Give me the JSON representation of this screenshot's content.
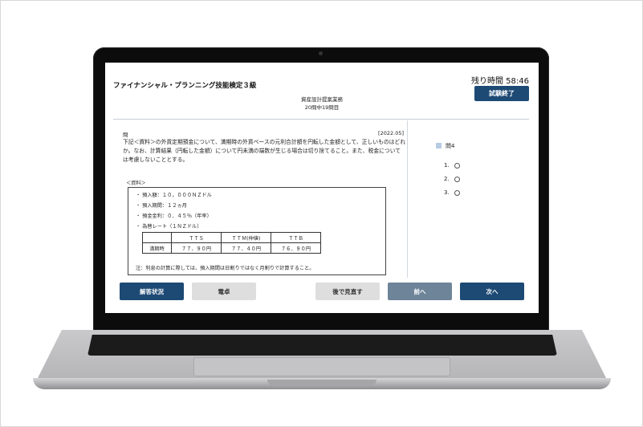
{
  "header": {
    "exam_title": "ファイナンシャル・プランニング技能検定３級",
    "timer": "残り時間 58:46",
    "end_button": "試験終了",
    "subject": "資産設計提案業務",
    "progress": "20問中19問目"
  },
  "question": {
    "label": "問",
    "year": "[2022.05]",
    "text": "下記＜資料＞の外貨定期預金について、満期時の外貨ベースの元利合計額を円転した金額として、正しいものはどれか。なお、計算結果（円転した金額）について円未満の端数が生じる場合は切り捨てること。また、税金については考慮しないこととする。"
  },
  "reference": {
    "label": "＜資料＞",
    "lines": [
      "・ 預入額：１０，０００ＮＺドル",
      "・ 預入期間：１２ヵ月",
      "・ 預金金利：０．４５％（年率）",
      "・ 為替レート（１ＮＺドル）"
    ],
    "table_header": [
      "",
      "ＴＴＳ",
      "ＴＴＭ(仲値)",
      "ＴＴＢ"
    ],
    "table_row": [
      "満期時",
      "７７．９０円",
      "７７．４０円",
      "７６．９０円"
    ],
    "note": "注：利息の計算に際しては、預入期間は日割りではなく月割りで計算すること。"
  },
  "sidebar": {
    "question_number": "問4",
    "options": [
      "1.",
      "2.",
      "3."
    ]
  },
  "footer": {
    "answer_status": "解答状況",
    "calculator": "電卓",
    "review_later": "後で見直す",
    "prev": "前へ",
    "next": "次へ"
  }
}
